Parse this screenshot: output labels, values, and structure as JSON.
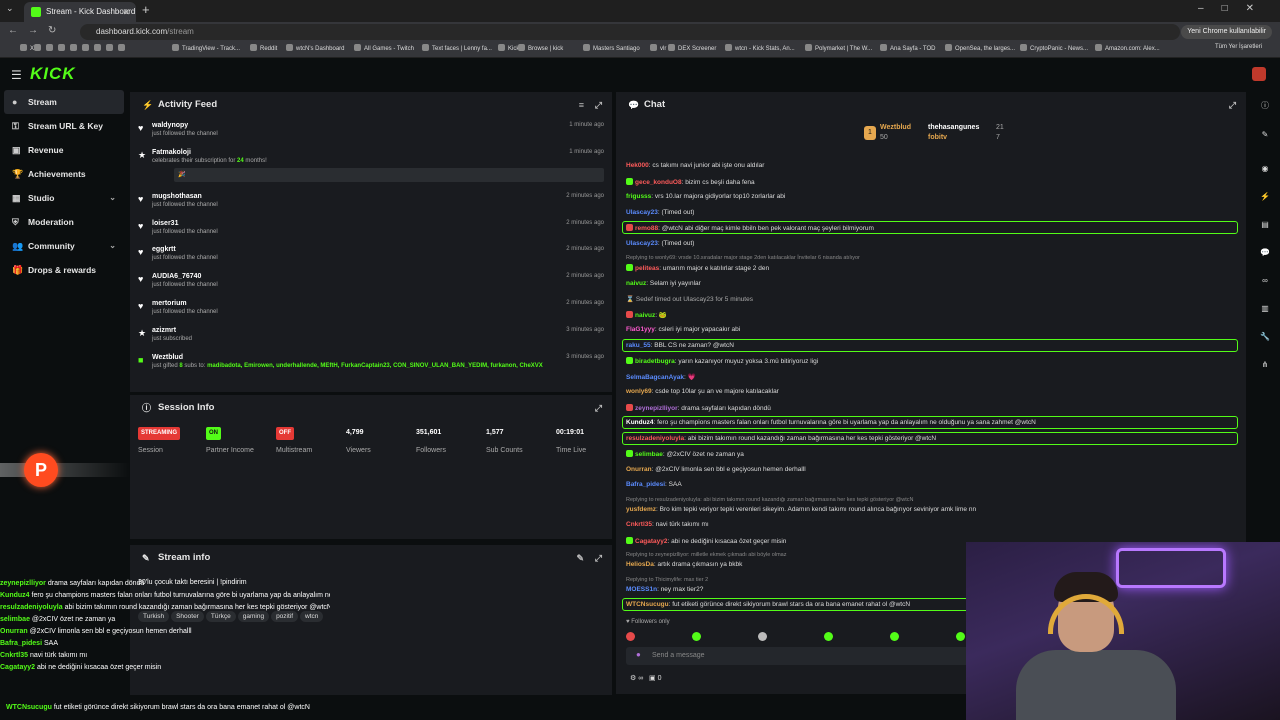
{
  "browser": {
    "tab_title": "Stream - Kick Dashboard",
    "url_host": "dashboard.kick.com",
    "url_path": "/stream",
    "chrome_button": "Yeni Chrome kullanılabilir",
    "bookmarks": [
      "X",
      "",
      "",
      "",
      "",
      "",
      "",
      "",
      "",
      "TradingView - Track...",
      "Reddit",
      "wtcN's Dashboard",
      "All Games - Twitch",
      "Text faces | Lenny fa...",
      "Kick",
      "Browse | kick",
      "Masters Santiago",
      "vlr",
      "DEX Screener",
      "wtcn - Kick Stats, An...",
      "Polymarket | The W...",
      "Ana Sayfa - TOD",
      "OpenSea, the larges...",
      "CryptoPanic - News...",
      "Amazon.com: Alex...",
      "Tüm Yer İşaretleri"
    ]
  },
  "app": {
    "logo": "KICK"
  },
  "sidebar": {
    "items": [
      {
        "label": "Stream",
        "icon": "broadcast-icon"
      },
      {
        "label": "Stream URL & Key",
        "icon": "key-icon"
      },
      {
        "label": "Revenue",
        "icon": "money-icon"
      },
      {
        "label": "Achievements",
        "icon": "trophy-icon"
      },
      {
        "label": "Studio",
        "icon": "studio-icon"
      },
      {
        "label": "Moderation",
        "icon": "shield-icon"
      },
      {
        "label": "Community",
        "icon": "people-icon"
      },
      {
        "label": "Drops & rewards",
        "icon": "gift-icon"
      }
    ]
  },
  "activity": {
    "title": "Activity Feed",
    "items": [
      {
        "name": "waldynopy",
        "desc": "just followed the channel",
        "time": "1 minute ago"
      },
      {
        "name": "Fatmakoloji",
        "desc_pre": "celebrates their subscription for ",
        "months": "24",
        "desc_post": " months!",
        "time": "1 minute ago",
        "box": "🎉"
      },
      {
        "name": "mugshothasan",
        "desc": "just followed the channel",
        "time": "2 minutes ago"
      },
      {
        "name": "loiser31",
        "desc": "just followed the channel",
        "time": "2 minutes ago"
      },
      {
        "name": "eggkrtt",
        "desc": "just followed the channel",
        "time": "2 minutes ago"
      },
      {
        "name": "AUDIA6_76740",
        "desc": "just followed the channel",
        "time": "2 minutes ago"
      },
      {
        "name": "mertorium",
        "desc": "just followed the channel",
        "time": "2 minutes ago"
      },
      {
        "name": "azizmrt",
        "desc": "just subscribed",
        "time": "3 minutes ago"
      },
      {
        "name": "Weztblud",
        "desc_pre": "just gifted ",
        "gift_count": "8",
        "desc_post": " subs to: ",
        "gift_list": "madibadota, Emirowen, underhallende, MEftH, FurkanCaptain23, CON_SINOV_ULAN_BAN_YEDIM, furkanon, CheXVX",
        "time": "3 minutes ago"
      }
    ]
  },
  "session": {
    "title": "Session Info",
    "stats": [
      {
        "value": "STREAMING",
        "label": "Session"
      },
      {
        "value": "ON",
        "label": "Partner Income"
      },
      {
        "value": "OFF",
        "label": "Multistream"
      },
      {
        "value": "4,799",
        "label": "Viewers"
      },
      {
        "value": "351,601",
        "label": "Followers"
      },
      {
        "value": "1,577",
        "label": "Sub Counts"
      },
      {
        "value": "00:19:01",
        "label": "Time Live"
      }
    ]
  },
  "stream_info": {
    "title": "Stream info",
    "stream_title": "30'lu çocuk taktı beresini | !pindirim",
    "tags": [
      "Turkish",
      "Shooter",
      "Türkçe",
      "gaming",
      "pozitif",
      "wtcn"
    ]
  },
  "chat": {
    "title": "Chat",
    "leaders": [
      {
        "name": "Weztblud",
        "count": "50"
      },
      {
        "name": "thehasangunes",
        "count": "21"
      },
      {
        "name": "fobitv",
        "count": "7"
      }
    ],
    "messages": [
      {
        "user": "Hek000",
        "color": "#ff5b5b",
        "text": "cs takımı navi junior abi işte onu aldılar"
      },
      {
        "user": "gece_konduO8",
        "color": "#ff5b5b",
        "text": "bizim cs beşli daha fena"
      },
      {
        "user": "frigusss",
        "color": "#53fc18",
        "text": "vrs 10.lar majora gidiyorlar top10 zorlarlar abi"
      },
      {
        "user": "Ulascay23",
        "color": "#5b8cff",
        "text": "(Timed out)"
      },
      {
        "user": "remo88",
        "color": "#ff5b5b",
        "text": "@wtcN abi diğer maç kimle bbiln ben pek valorant maç şeyleri bilmiyorum"
      },
      {
        "user": "Ulascay23",
        "color": "#5b8cff",
        "text": "(Timed out)"
      },
      {
        "reply": "Replying to wonly69: vrsde 10.sıradalar major stage 2den katılacaklar İnvitelar 6 nisanda atılıyor"
      },
      {
        "user": "peliteas",
        "color": "#ff5b5b",
        "text": "umarım major e katılırlar stage 2 den"
      },
      {
        "user": "naivuz",
        "color": "#53fc18",
        "text": "Selam iyi yayınlar"
      },
      {
        "system": "Sedef timed out Ulascay23 for 5 minutes"
      },
      {
        "user": "naivuz",
        "color": "#53fc18",
        "text": "🐸"
      },
      {
        "user": "FlaG1yyy",
        "color": "#ff5bd0",
        "text": "csleri iyi major yapacakır abi"
      },
      {
        "user": "raku_55",
        "color": "#5b8cff",
        "text": "BBL CS ne zaman? @wtcN"
      },
      {
        "user": "biradetbugra",
        "color": "#53fc18",
        "text": "yarın kazanıyor muyuz yoksa 3.mü bitiriyoruz ligi"
      },
      {
        "user": "SelmaBagcanAyak",
        "color": "#5b8cff",
        "text": "💗"
      },
      {
        "user": "wonly69",
        "color": "#e6a84f",
        "text": "csde top 10lar şu an ve majore katılacaklar"
      },
      {
        "user": "zeynepizlliyor",
        "color": "#b06fd8",
        "text": "drama sayfaları kapıdan döndü"
      },
      {
        "user": "Kunduz4",
        "color": "#ffffff",
        "text": "fero şu champions masters falan onları futbol turnuvalarına göre bi uyarlama yap da anlayalım ne olduğunu ya sana zahmet @wtcN"
      },
      {
        "user": "resulzadeniyoluyla",
        "color": "#ff5b5b",
        "text": "abi bizim takımın round kazandığı zaman bağırmasına her kes tepki gösteriyor @wtcN"
      },
      {
        "user": "selimbae",
        "color": "#53fc18",
        "text": "@2xCIV özet ne zaman ya"
      },
      {
        "user": "Onurran",
        "color": "#e6a84f",
        "text": "@2xCIV limonla sen bbl e geçiyosun hemen derhalll"
      },
      {
        "user": "Bafra_pidesi",
        "color": "#5b8cff",
        "text": "SAA"
      },
      {
        "reply": "Replying to resulzadeniyoluyla: abi bizim takımın round kazandığı zaman bağırmasına her kes tepki gösteriyor @wtcN"
      },
      {
        "user": "yusfdemz",
        "color": "#e6a84f",
        "text": "Bro kim tepki veriyor tepki verenleri sikeyim. Adamın kendi takımı round alınca bağırıyor seviniyor amk lime nn"
      },
      {
        "user": "Cnkrtl35",
        "color": "#ff5b5b",
        "text": "navi türk takımı mı"
      },
      {
        "user": "Cagatayy2",
        "color": "#ff5b5b",
        "text": "abi ne dediğini kısacaa özet geçer misin"
      },
      {
        "reply": "Replying to zeynepizlliyor: milletle ekmek çıkmadı abi böyle olmaz"
      },
      {
        "user": "HeliosDa",
        "color": "#e6a84f",
        "text": "artık drama çıkmasın ya bkbk"
      },
      {
        "reply": "Replying to Thicimylife: max tier 2"
      },
      {
        "user": "MOESS1n",
        "color": "#5b8cff",
        "text": "ney max tier2?"
      },
      {
        "user": "WTCNsucugu",
        "color": "#e6a84f",
        "text": "fut etiketi görünce direkt sikiyorum brawl stars da ora bana emanet rahat ol @wtcN"
      }
    ],
    "followers_only": "Followers only",
    "input_placeholder": "Send a message",
    "bottom_count": "0"
  },
  "overlay_chat": [
    {
      "user": "zeynepizlliyor",
      "text": "drama sayfaları kapıdan döndü"
    },
    {
      "user": "Kunduz4",
      "text": "fero şu champions masters falan onları futbol turnuvalarına göre bi uyarlama yap da anlayalım ne olduğunu ya sana zahmet @wtcN"
    },
    {
      "user": "resulzadeniyoluyla",
      "text": "abi bizim takımın round kazandığı zaman bağırmasına her kes tepki gösteriyor @wtcN"
    },
    {
      "user": "selimbae",
      "text": "@2xCIV özet ne zaman ya"
    },
    {
      "user": "Onurran",
      "text": "@2xCIV limonla sen bbl e geçiyosun hemen derhalll"
    },
    {
      "user": "Bafra_pidesi",
      "text": "SAA"
    },
    {
      "user": "Cnkrtl35",
      "text": "navi türk takımı mı"
    },
    {
      "user": "Cagatayy2",
      "text": "abi ne dediğini kısacaa özet geçer misin"
    },
    {
      "user": "WTCNsucugu",
      "text": "fut etiketi görünce direkt sikiyorum brawl stars da ora bana emanet rahat ol @wtcN"
    }
  ]
}
